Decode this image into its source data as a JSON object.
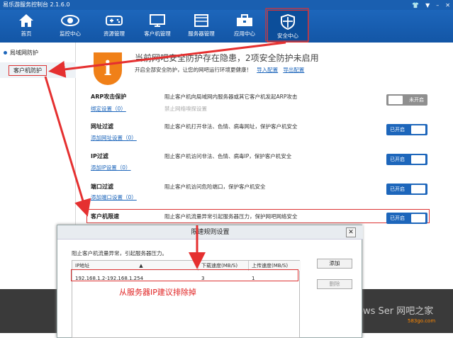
{
  "app": {
    "title": "易乐游服务控制台 2.1.6.0"
  },
  "window_controls": [
    "👕",
    "▼",
    "–",
    "✕"
  ],
  "nav": [
    {
      "label": "首页",
      "icon": "home-icon"
    },
    {
      "label": "监控中心",
      "icon": "eye-icon"
    },
    {
      "label": "资源管理",
      "icon": "gamepad-icon"
    },
    {
      "label": "客户机管理",
      "icon": "monitor-icon"
    },
    {
      "label": "服务器管理",
      "icon": "server-icon"
    },
    {
      "label": "应用中心",
      "icon": "toolbox-icon"
    },
    {
      "label": "安全中心",
      "icon": "shield-icon",
      "active": true
    }
  ],
  "sidebar": {
    "items": [
      {
        "label": "局域网防护"
      },
      {
        "label": "客户机防护"
      }
    ]
  },
  "alert": {
    "icon_char": "i",
    "title": "当前网吧安全防护存在隐患，2项安全防护未启用",
    "subtitle": "开启全部安全防护，让您的网吧运行环境更健康！",
    "import_label": "导入配置",
    "export_label": "导出配置"
  },
  "sections": [
    {
      "title": "ARP攻击保护",
      "link": "绑定设置（0）",
      "desc": "阻止客户机向局域网内服务器或其它客户机发起ARP攻击",
      "sub": "禁止网络嗅探设置",
      "toggle": "未开启",
      "on": false
    },
    {
      "title": "网址过滤",
      "link": "添加网址设置（0）",
      "desc": "阻止客户机打开非法、色情、病毒网址，保护客户机安全",
      "sub": "",
      "toggle": "已开启",
      "on": true
    },
    {
      "title": "IP过滤",
      "link": "添加IP设置（0）",
      "desc": "阻止客户机访问非法、色情、病毒IP，保护客户机安全",
      "sub": "",
      "toggle": "已开启",
      "on": true
    },
    {
      "title": "端口过滤",
      "link": "添加端口设置（0）",
      "desc": "阻止客户机访问危险端口，保护客户机安全",
      "sub": "",
      "toggle": "已开启",
      "on": true
    },
    {
      "title": "客户机限速",
      "link": "",
      "desc": "阻止客户机流量异常引起服务器压力，保护网吧网络安全",
      "sub": "",
      "toggle": "已开启",
      "on": true
    }
  ],
  "dialog": {
    "title": "限速规则设置",
    "close": "✕",
    "desc": "阻止客户机流量异常，引起服务器压力。",
    "columns": [
      "IP地址",
      "下载速度(MB/S)",
      "上传速度(MB/S)"
    ],
    "rows": [
      {
        "ip": "192.168.1.2-192.168.1.254",
        "down": "3",
        "up": "1"
      }
    ],
    "add_label": "添加",
    "delete_label": "删除"
  },
  "note": "从服务器IP建议排除掉",
  "watermark": {
    "main": "ows Ser 网吧之家",
    "site": "583go.com"
  }
}
